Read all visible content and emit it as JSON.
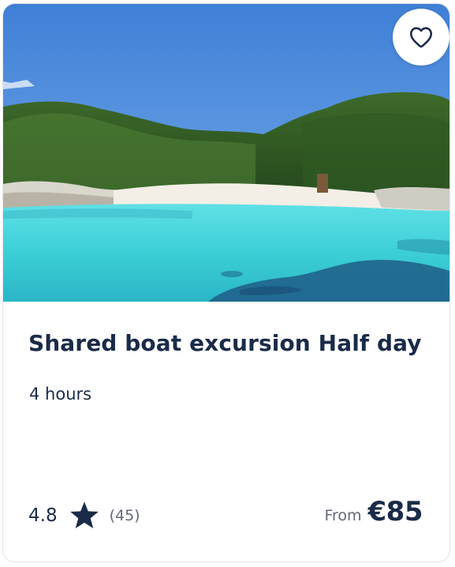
{
  "card": {
    "image": {
      "alt": "Turquoise bay with white sand beach and pine-covered hills"
    },
    "favorite_icon": "heart-outline-icon",
    "title": "Shared boat excursion Half day",
    "duration": "4 hours",
    "rating": {
      "value": "4.8",
      "star_icon": "star-icon",
      "count": "(45)"
    },
    "price": {
      "prefix": "From",
      "value": "€85"
    }
  },
  "colors": {
    "title": "#1a2b49",
    "muted": "#63687a",
    "sky": "#4a88d8",
    "water": "#3fd0d8"
  }
}
